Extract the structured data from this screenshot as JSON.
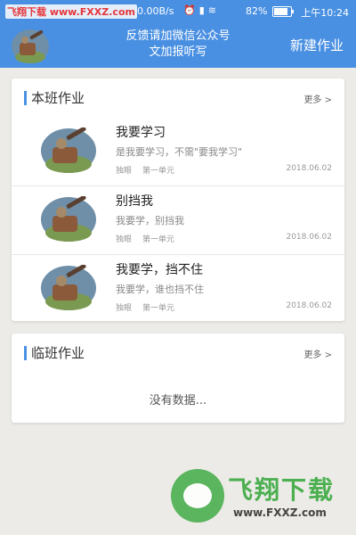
{
  "status_bar": {
    "watermark": "飞翔下载 www.FXXZ.com",
    "net_speed": "0.00B/s",
    "battery": "82%",
    "time": "上午10:24"
  },
  "header": {
    "notice_line1": "反馈请加微信公众号",
    "notice_line2": "文加报听写",
    "new_button": "新建作业"
  },
  "my_class": {
    "title": "本班作业",
    "more": "更多 >",
    "items": [
      {
        "title": "我要学习",
        "desc": "是我要学习，不需\"要我学习\"",
        "author": "独眼",
        "unit": "第一单元",
        "date": "2018.06.02"
      },
      {
        "title": "别挡我",
        "desc": "我要学，别挡我",
        "author": "独眼",
        "unit": "第一单元",
        "date": "2018.06.02"
      },
      {
        "title": "我要学，挡不住",
        "desc": "我要学，谁也挡不住",
        "author": "独眼",
        "unit": "第一单元",
        "date": "2018.06.02"
      }
    ]
  },
  "other_class": {
    "title": "临班作业",
    "more": "更多 >",
    "empty": "没有数据..."
  },
  "watermark": {
    "title": "飞翔下载",
    "url": "www.FXXZ.com"
  },
  "colors": {
    "accent": "#4a90e2",
    "background": "#ecebe7",
    "watermark_green": "#4caf50"
  }
}
